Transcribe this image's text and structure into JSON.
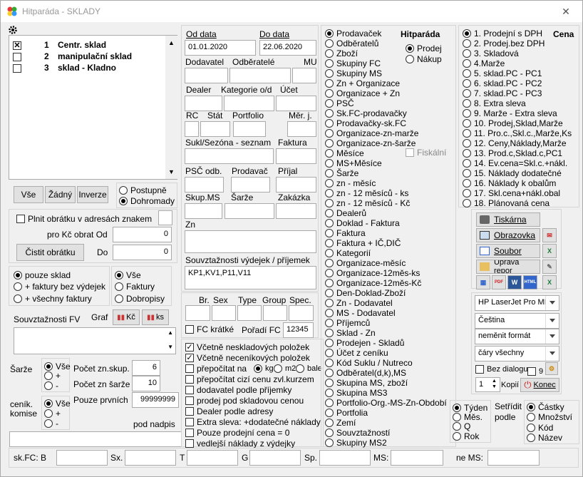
{
  "window": {
    "title": "Hitparáda - SKLADY"
  },
  "warehouses": [
    {
      "num": "1",
      "name": "Centr. sklad",
      "checked": true
    },
    {
      "num": "2",
      "name": "manipulační sklad",
      "checked": false
    },
    {
      "num": "3",
      "name": "sklad - Kladno",
      "checked": false
    }
  ],
  "select_buttons": {
    "all": "Vše",
    "none": "Žádný",
    "invert": "Inverze"
  },
  "order_mode": {
    "gradual": "Postupně",
    "together": "Dohromady"
  },
  "turnover": {
    "fill_label": "Plnit obrátku v adresách znakem",
    "from_label": "pro Kč obrat Od",
    "from_value": "0",
    "to_label": "Do",
    "to_value": "0",
    "clear_label": "Čistit obrátku"
  },
  "scope": {
    "only_warehouse": "pouze sklad",
    "invoices_without": "+ faktury bez výdejek",
    "all_invoices": "+ všechny faktury"
  },
  "doc_type": {
    "all": "Vše",
    "invoices": "Faktury",
    "delivery": "Dobropisy"
  },
  "fv_label": "Souvztažnosti FV",
  "graph_label": "Graf",
  "kc_label": "Kč",
  "ks_label": "ks",
  "batches": {
    "label": "Šarže",
    "all": "Vše",
    "plus": "+",
    "minus": "-"
  },
  "counts": {
    "groups_label": "Počet zn.skup.",
    "groups_value": "6",
    "batch_label": "Počet zn šarže",
    "batch_value": "10",
    "first_label": "Pouze prvních",
    "first_value": "99999999"
  },
  "price_comm": {
    "label1": "ceník.",
    "label2": "komise",
    "all": "Vše",
    "plus": "+",
    "minus": "-"
  },
  "subtitle_label": "pod nadpis",
  "dates": {
    "from_label": "Od data",
    "from_value": "01.01.2020",
    "to_label": "Do data",
    "to_value": "22.06.2020"
  },
  "filters": {
    "supplier": "Dodavatel",
    "customers": "Odběratelé",
    "mu": "MU",
    "dealer": "Dealer",
    "category": "Kategorie o/d",
    "account": "Účet",
    "rc": "RC",
    "state": "Stát",
    "portfolio": "Portfolio",
    "unit": "Měr. j.",
    "sukl": "Sukl/Sezóna - seznam",
    "invoice": "Faktura",
    "psc": "PSČ odb.",
    "seller": "Prodavač",
    "receipt": "Příjal",
    "skup": "Skup.MS",
    "batch": "Šarže",
    "order": "Zakázka",
    "zn": "Zn",
    "rel_label": "Souvztažnosti výdejek / příjemek",
    "rel_value": "KP1,KV1,P11,V11"
  },
  "spec": {
    "br": "Br.",
    "sex": "Sex",
    "type": "Type",
    "group": "Group",
    "spec": "Spec.",
    "fc_short": "FC krátké",
    "order_fc": "Pořadí FC",
    "order_fc_value": "12345"
  },
  "options": [
    "Včetně neskladových položek",
    "Včetně neceníkových položek",
    "přepočítat na",
    "přepočítat cizí cenu zvl.kurzem",
    "dodavatel podle příjemky",
    "prodej pod skladovou cenou",
    "Dealer podle adresy",
    "Extra sleva: +dodatečné náklady",
    "Pouze prodejní cena = 0",
    "vedlejší náklady z výdejky"
  ],
  "options_checked": [
    true,
    true,
    false,
    false,
    false,
    false,
    false,
    false,
    false,
    false
  ],
  "recalc": {
    "kg": "kg",
    "m2": "m2",
    "bale": "bale"
  },
  "reports": [
    "Prodavaček",
    "Odběratelů",
    "Zboží",
    "Skupiny FC",
    "Skupiny MS",
    "Zn + Organizace",
    "Organizace + Zn",
    "PSČ",
    "Sk.FC-prodavačky",
    "Prodavačky-sk.FC",
    "Organizace-zn-marže",
    "Organizace-zn-šarže",
    "Měsíce",
    "MS+Měsíce",
    "Šarže",
    "zn - měsíc",
    "zn - 12 měsíců - ks",
    "zn - 12 měsíců - Kč",
    "Dealerů",
    "Doklad - Faktura",
    "Faktura",
    "Faktura + IČ,DIČ",
    "Kategorií",
    "Organizace-měsíc",
    "Organizace-12měs-ks",
    "Organizace-12měs-Kč",
    "Den-Doklad-Zboží",
    "Zn - Dodavatel",
    "MS - Dodavatel",
    "Příjemců",
    "Sklad - Zn",
    "Prodejen - Skladů",
    "Účet z ceníku",
    "Kód Suklu / Nutreco",
    "Odběratel(d,k),MS",
    "Skupina MS, zboží",
    "Skupina MS3",
    "Portfolio-Org.-MS-Zn-Období",
    "Portfolia",
    "Zemí",
    "Souvztažností",
    "Skupiny MS2"
  ],
  "hitparade": {
    "label": "Hitparáda",
    "sale": "Prodej",
    "purchase": "Nákup",
    "fiscal": "Fiskální"
  },
  "prices": {
    "label": "Cena",
    "items": [
      "1. Prodejní s DPH",
      "2. Prodej.bez DPH",
      "3. Skladová",
      "4.Marže",
      "5. sklad.PC - PC1",
      "6. sklad.PC - PC2",
      "7. sklad.PC - PC3",
      "8. Extra sleva",
      "9. Marže - Extra sleva",
      "10. Prodej,Sklad,Marže",
      "11. Pro.c.,Skl.c.,Marže,Ks",
      "12. Ceny,Náklady,Marže",
      "13. Prod.c,Sklad.c,PC1",
      "14. Ev.cena=Skl.c.+nákl.",
      "15. Náklady dodatečné",
      "16. Náklady k obalům",
      "17. Skl.cena+nákl.obal",
      "18. Plánovaná cena"
    ]
  },
  "output": {
    "print": "Tiskárna",
    "screen": "Obrazovka",
    "file": "Soubor",
    "edit": "Úprava repor",
    "printer": "HP LaserJet Pro MFP",
    "language": "Čeština",
    "format": "neměnit formát",
    "lines": "čáry všechny",
    "no_dialog": "Bez dialogu",
    "nine": "9",
    "copies_label": "Kopií",
    "copies_value": "1",
    "end": "Konec",
    "pdf": "PDF",
    "html": "HTML"
  },
  "period": {
    "week": "Týden",
    "month": "Měs.",
    "quarter": "Q",
    "year": "Rok"
  },
  "sort": {
    "label1": "Setřídit",
    "label2": "podle",
    "amounts": "Částky",
    "qty": "Množství",
    "code": "Kód",
    "name": "Název"
  },
  "status": {
    "skfc": "sk.FC: B",
    "sx": "Sx.",
    "t": "T",
    "g": "G",
    "sp": "Sp.",
    "ms": "MS:",
    "ne_ms": "ne MS:"
  },
  "colors": {
    "accent": "#0078d7",
    "end_icon": "#d42020"
  }
}
